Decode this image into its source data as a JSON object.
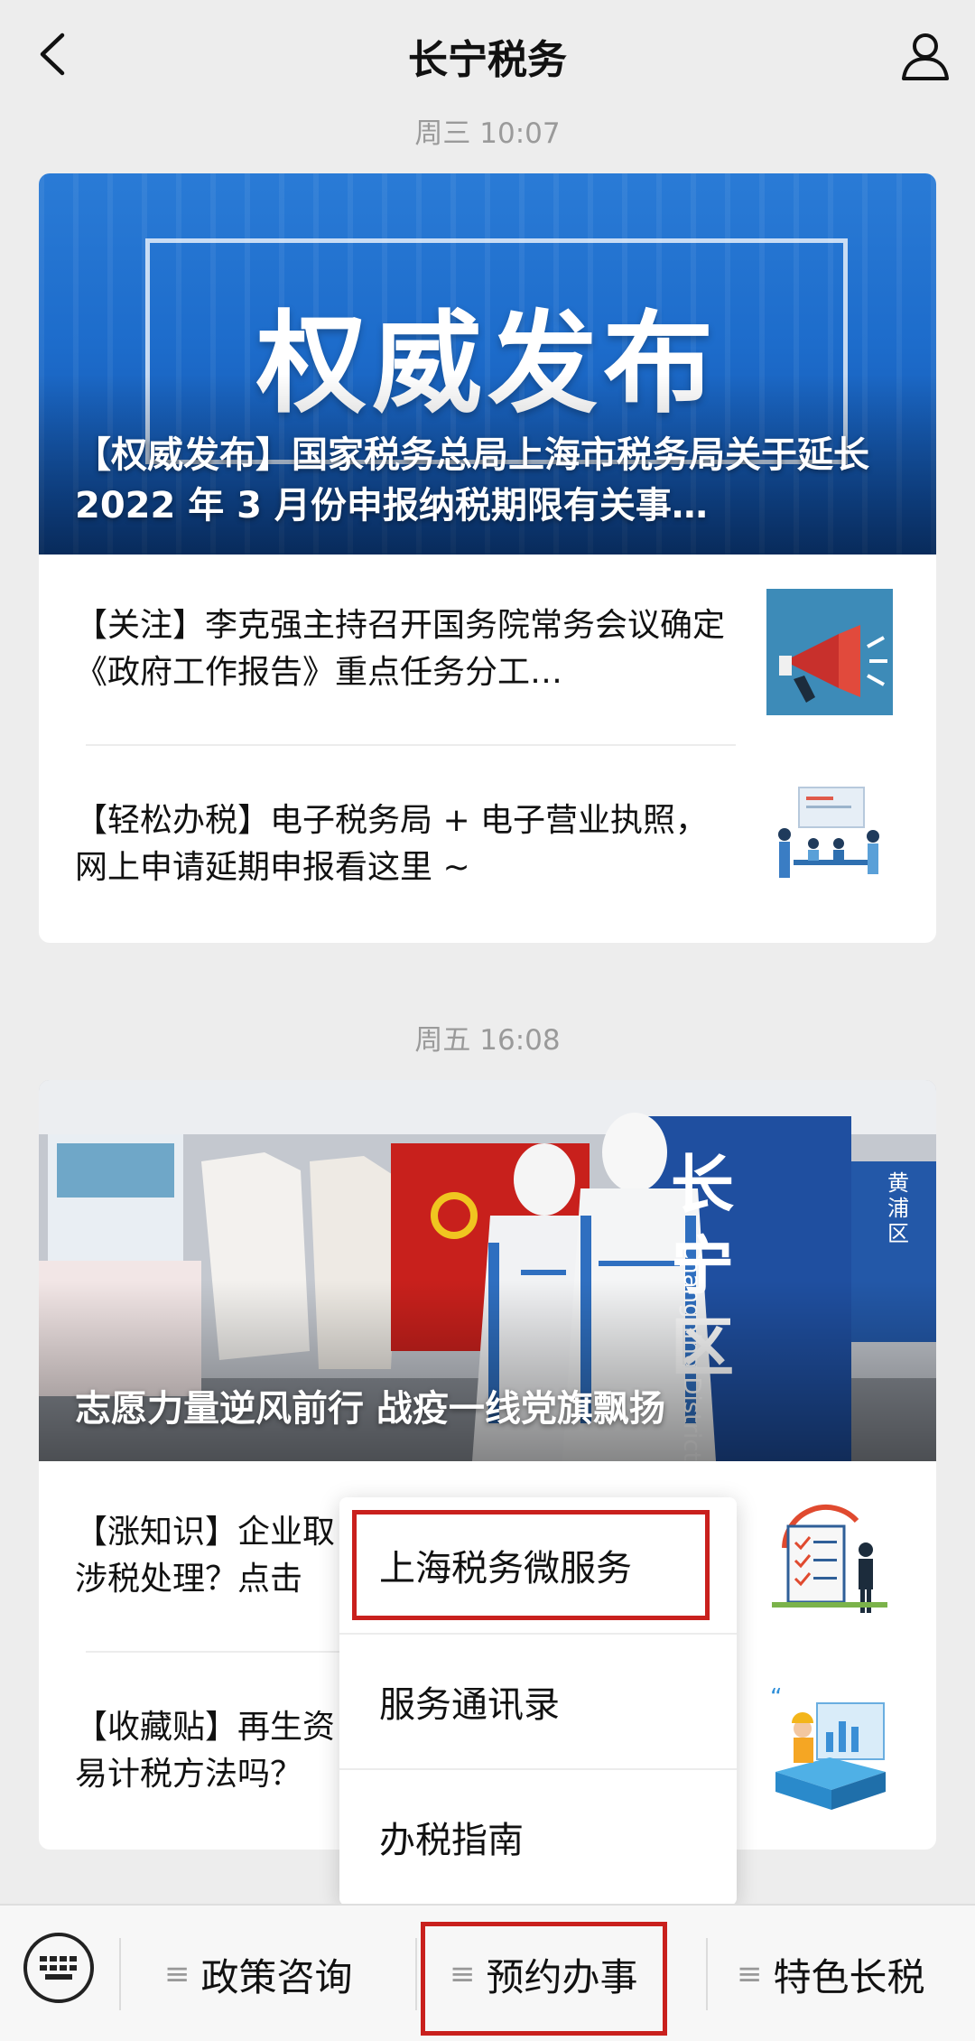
{
  "header": {
    "title": "长宁税务"
  },
  "groups": [
    {
      "time": "周三 10:07",
      "hero": {
        "big_text": "权威发布",
        "caption": "【权威发布】国家税务总局上海市税务局关于延长 2022 年 3 月份申报纳税期限有关事…"
      },
      "articles": [
        {
          "title": "【关注】李克强主持召开国务院常务会议确定《政府工作报告》重点任务分工…",
          "thumb": "megaphone-icon"
        },
        {
          "title": "【轻松办税】电子税务局 + 电子营业执照，网上申请延期申报看这里 ~",
          "thumb": "meeting-illustration"
        }
      ]
    },
    {
      "time": "周五 16:08",
      "hero": {
        "caption": "志愿力量逆风前行 战疫一线党旗飘扬",
        "photo_signs": [
          "长",
          "宁",
          "区",
          "Changning District",
          "黄浦区"
        ]
      },
      "articles": [
        {
          "title": "【涨知识】企业取",
          "title2": "涉税处理？点击",
          "thumb": "checklist-illustration"
        },
        {
          "title": "【收藏贴】再生资",
          "title2": "易计税方法吗？",
          "thumb": "worker-illustration"
        }
      ]
    }
  ],
  "popup_menu": {
    "items": [
      "上海税务微服务",
      "服务通讯录",
      "办税指南"
    ],
    "highlighted_index": 0
  },
  "bottom_bar": {
    "items": [
      "政策咨询",
      "预约办事",
      "特色长税"
    ],
    "highlighted_index": 1
  },
  "colors": {
    "highlight": "#c9201d",
    "background": "#ededed"
  }
}
